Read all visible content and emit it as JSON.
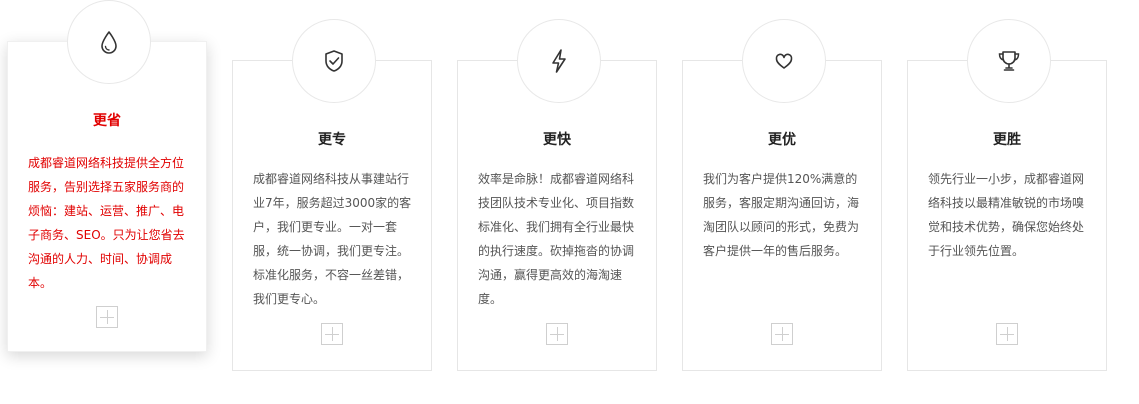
{
  "colors": {
    "accent": "#e10000",
    "text": "#555555",
    "title": "#222222",
    "border": "#e6e6e6",
    "icon": "#333333"
  },
  "cards": [
    {
      "icon": "droplet-icon",
      "title": "更省",
      "text": "成都睿道网络科技提供全方位服务，告别选择五家服务商的烦恼：建站、运营、推广、电子商务、SEO。只为让您省去沟通的人力、时间、协调成本。",
      "active": true
    },
    {
      "icon": "shield-check-icon",
      "title": "更专",
      "text": "成都睿道网络科技从事建站行业7年，服务超过3000家的客户，我们更专业。一对一套服，统一协调，我们更专注。标准化服务，不容一丝差错，我们更专心。",
      "active": false
    },
    {
      "icon": "lightning-icon",
      "title": "更快",
      "text": "效率是命脉！成都睿道网络科技团队技术专业化、项目指数标准化、我们拥有全行业最快的执行速度。砍掉拖沓的协调沟通，赢得更高效的海淘速度。",
      "active": false
    },
    {
      "icon": "heart-icon",
      "title": "更优",
      "text": "我们为客户提供120%满意的服务，客服定期沟通回访，海淘团队以顾问的形式，免费为客户提供一年的售后服务。",
      "active": false
    },
    {
      "icon": "trophy-icon",
      "title": "更胜",
      "text": "领先行业一小步，成都睿道网络科技以最精准敏锐的市场嗅觉和技术优势，确保您始终处于行业领先位置。",
      "active": false
    }
  ]
}
